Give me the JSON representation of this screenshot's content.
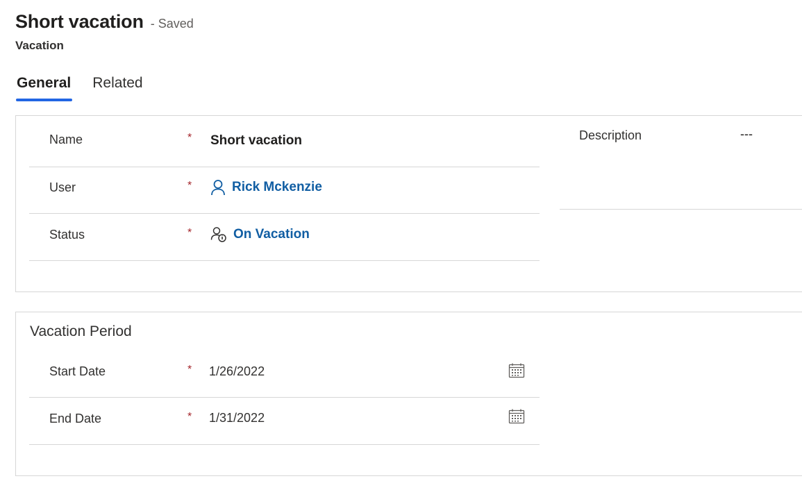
{
  "header": {
    "title": "Short vacation",
    "save_status": "- Saved",
    "entity": "Vacation"
  },
  "tabs": [
    {
      "label": "General",
      "active": true
    },
    {
      "label": "Related",
      "active": false
    }
  ],
  "general_section": {
    "fields": {
      "name": {
        "label": "Name",
        "required": "*",
        "value": "Short vacation"
      },
      "user": {
        "label": "User",
        "required": "*",
        "value": "Rick Mckenzie",
        "icon": "person-icon"
      },
      "status": {
        "label": "Status",
        "required": "*",
        "value": "On Vacation",
        "icon": "user-status-icon"
      }
    },
    "description": {
      "label": "Description",
      "value": "---"
    }
  },
  "period_section": {
    "title": "Vacation Period",
    "fields": {
      "start_date": {
        "label": "Start Date",
        "required": "*",
        "value": "1/26/2022",
        "icon": "calendar-icon"
      },
      "end_date": {
        "label": "End Date",
        "required": "*",
        "value": "1/31/2022",
        "icon": "calendar-icon"
      }
    }
  },
  "colors": {
    "accent": "#2266e3",
    "link": "#115ea3",
    "required": "#a4262c",
    "border": "#d6d6d6"
  }
}
